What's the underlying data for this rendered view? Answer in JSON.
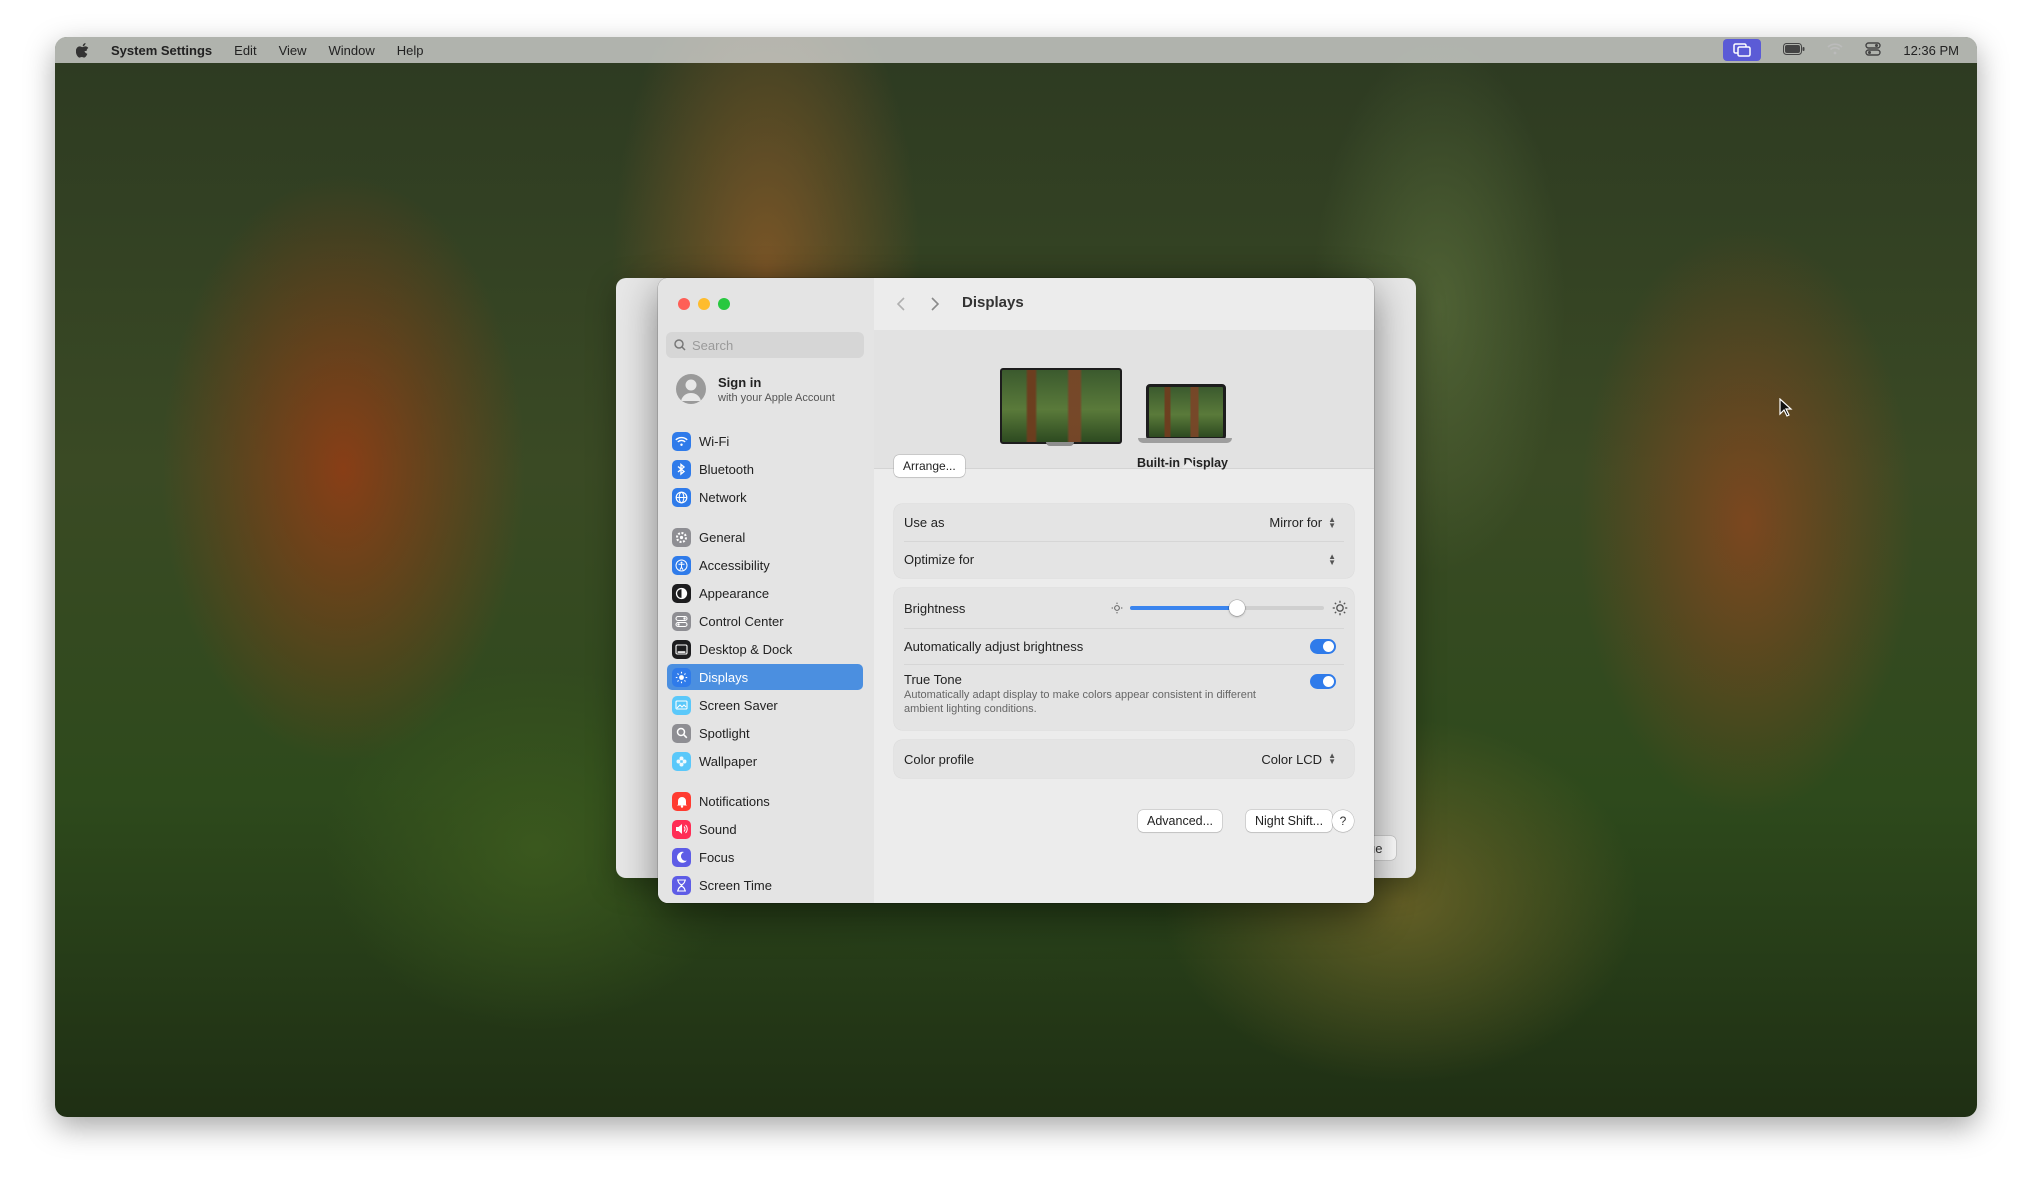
{
  "menubar": {
    "app_name": "System Settings",
    "items": [
      "Edit",
      "View",
      "Window",
      "Help"
    ],
    "time": "12:36 PM"
  },
  "background_window": {
    "button_partial": "ue"
  },
  "sidebar": {
    "search_placeholder": "Search",
    "account": {
      "title": "Sign in",
      "subtitle": "with your Apple Account"
    },
    "items": [
      {
        "label": "Wi-Fi",
        "icon": "wifi-icon",
        "color": "#2f7bea"
      },
      {
        "label": "Bluetooth",
        "icon": "bluetooth-icon",
        "color": "#2f7bea"
      },
      {
        "label": "Network",
        "icon": "globe-icon",
        "color": "#2f7bea"
      },
      {
        "label": "General",
        "icon": "gear-icon",
        "color": "#8e8e93"
      },
      {
        "label": "Accessibility",
        "icon": "accessibility-icon",
        "color": "#2f7bea"
      },
      {
        "label": "Appearance",
        "icon": "appearance-icon",
        "color": "#1d1d1f"
      },
      {
        "label": "Control Center",
        "icon": "control-center-icon",
        "color": "#8e8e93"
      },
      {
        "label": "Desktop & Dock",
        "icon": "dock-icon",
        "color": "#1d1d1f"
      },
      {
        "label": "Displays",
        "icon": "sun-icon",
        "color": "#2f7bea"
      },
      {
        "label": "Screen Saver",
        "icon": "screen-saver-icon",
        "color": "#5ac8fa"
      },
      {
        "label": "Spotlight",
        "icon": "magnifier-icon",
        "color": "#8e8e93"
      },
      {
        "label": "Wallpaper",
        "icon": "flower-icon",
        "color": "#5ac8fa"
      },
      {
        "label": "Notifications",
        "icon": "bell-icon",
        "color": "#ff3b30"
      },
      {
        "label": "Sound",
        "icon": "speaker-icon",
        "color": "#ff2d55"
      },
      {
        "label": "Focus",
        "icon": "moon-icon",
        "color": "#5e5ce6"
      },
      {
        "label": "Screen Time",
        "icon": "hourglass-icon",
        "color": "#5e5ce6"
      }
    ],
    "selected": "Displays"
  },
  "main": {
    "title": "Displays",
    "arrange_label": "Arrange...",
    "selected_display": "Built-in Display",
    "use_as": {
      "label": "Use as",
      "value": "Mirror for"
    },
    "optimize_for": {
      "label": "Optimize for",
      "value": ""
    },
    "brightness": {
      "label": "Brightness",
      "value": 0.55
    },
    "auto_brightness": {
      "label": "Automatically adjust brightness",
      "on": true
    },
    "true_tone": {
      "label": "True Tone",
      "description_line1": "Automatically adapt display to make colors appear consistent in different",
      "description_line2": "ambient lighting conditions.",
      "on": true
    },
    "color_profile": {
      "label": "Color profile",
      "value": "Color LCD"
    },
    "buttons": {
      "advanced": "Advanced...",
      "night_shift": "Night Shift...",
      "help": "?"
    }
  },
  "colors": {
    "accent": "#2f7bea",
    "selection": "#4b8fe0"
  }
}
